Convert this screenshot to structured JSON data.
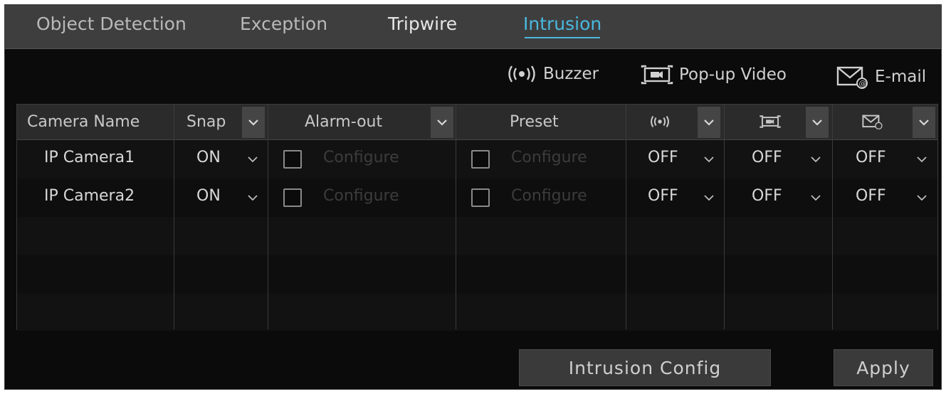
{
  "tabs": [
    {
      "label": "Object Detection",
      "active": false
    },
    {
      "label": "Exception",
      "active": false
    },
    {
      "label": "Tripwire",
      "active": false
    },
    {
      "label": "Intrusion",
      "active": true
    }
  ],
  "legend": {
    "buzzer": "Buzzer",
    "popup_video": "Pop-up Video",
    "email": "E-mail"
  },
  "table": {
    "headers": {
      "camera_name": "Camera Name",
      "snap": "Snap",
      "alarm_out": "Alarm-out",
      "preset": "Preset"
    },
    "rows": [
      {
        "camera": "IP Camera1",
        "snap": "ON",
        "alarm_out": "Configure",
        "preset": "Configure",
        "buzzer": "OFF",
        "popup": "OFF",
        "email": "OFF"
      },
      {
        "camera": "IP Camera2",
        "snap": "ON",
        "alarm_out": "Configure",
        "preset": "Configure",
        "buzzer": "OFF",
        "popup": "OFF",
        "email": "OFF"
      }
    ]
  },
  "buttons": {
    "intrusion_config": "Intrusion Config",
    "apply": "Apply"
  },
  "colors": {
    "accent": "#4ab8df",
    "background": "#0b0b0b",
    "tabbar": "#3e3e3e",
    "header": "#2b2b2b",
    "button": "#3a3a3a"
  }
}
